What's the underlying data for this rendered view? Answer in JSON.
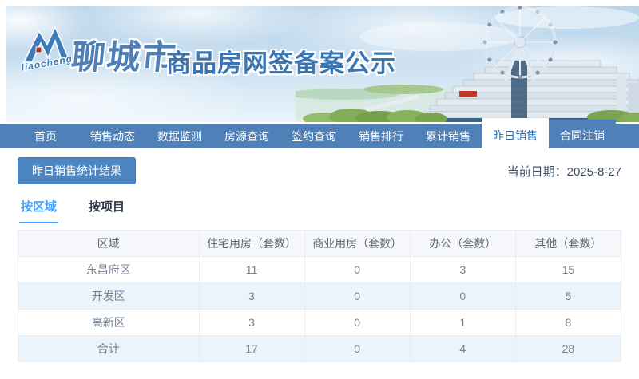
{
  "colors": {
    "nav_bar": "#4f81b8",
    "nav_active_text": "#2d6ca5",
    "banner_title_blue": "#3b76b2",
    "section_button_bg": "#4e86c2",
    "section_button_border": "#3f78b4",
    "tab_active_blue": "#409eff",
    "date_text": "#3f4d66",
    "table_header_bg": "#f5f7fa",
    "table_zebra_bg": "#ecf4fb",
    "table_border": "#e9ecf0",
    "table_text": "#76808d"
  },
  "banner": {
    "logo_script": "liaocheng",
    "city_name": "聊城市",
    "title": "商品房网签备案公示"
  },
  "nav": {
    "items": [
      {
        "label": "首页"
      },
      {
        "label": "销售动态"
      },
      {
        "label": "数据监测"
      },
      {
        "label": "房源查询"
      },
      {
        "label": "签约查询"
      },
      {
        "label": "销售排行"
      },
      {
        "label": "累计销售"
      },
      {
        "label": "昨日销售",
        "active": true
      },
      {
        "label": "合同注销"
      }
    ]
  },
  "content": {
    "section_button": "昨日销售统计结果",
    "date_label": "当前日期：",
    "date_value": "2025-8-27",
    "tabs": [
      {
        "label": "按区域",
        "active": true
      },
      {
        "label": "按项目",
        "active": false
      }
    ]
  },
  "table": {
    "headers": [
      "区域",
      "住宅用房（套数）",
      "商业用房（套数）",
      "办公（套数）",
      "其他（套数）"
    ],
    "rows": [
      {
        "cells": [
          "东昌府区",
          "11",
          "0",
          "3",
          "15"
        ]
      },
      {
        "cells": [
          "开发区",
          "3",
          "0",
          "0",
          "5"
        ]
      },
      {
        "cells": [
          "高新区",
          "3",
          "0",
          "1",
          "8"
        ]
      },
      {
        "cells": [
          "合计",
          "17",
          "0",
          "4",
          "28"
        ]
      }
    ]
  }
}
